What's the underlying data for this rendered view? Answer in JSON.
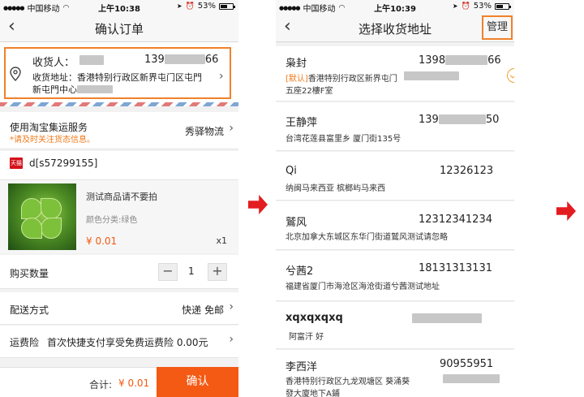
{
  "status_bar": {
    "carrier": "中国移动",
    "wifi_icon": "wifi-icon",
    "left_time": "上午10:38",
    "right_time": "上午10:39",
    "battery": "53%"
  },
  "order_screen": {
    "title": "确认订单",
    "back_icon": "chevron-left-icon",
    "recipient_label": "收货人：",
    "recipient_phone_visible": "139",
    "recipient_phone_tail": "66",
    "address_label": "收货地址：",
    "address_line1": "香港特别行政区新界屯门区屯門",
    "address_line2": "新屯門中心",
    "shipping_service_label": "使用淘宝集运服务",
    "shipping_service_value": "秀驿物流",
    "shipping_note": "*请及时关注货态信息。",
    "shop_badge": "天猫",
    "shop_name": "d[s57299155]",
    "product_title": "测试商品请不要拍",
    "product_spec": "颜色分类:绿色",
    "product_price": "¥ 0.01",
    "product_qty": "x1",
    "quantity_label": "购买数量",
    "quantity_minus": "−",
    "quantity_value": "1",
    "quantity_plus": "+",
    "delivery_label": "配送方式",
    "delivery_value": "快递 免邮",
    "insurance_label": "运费险",
    "insurance_value": "首次快捷支付享受免费运费险 0.00元",
    "total_label": "合计:",
    "total_value": "¥ 0.01",
    "confirm_button": "确认"
  },
  "address_screen": {
    "title": "选择收货地址",
    "manage_button": "管理",
    "addresses": [
      {
        "name": "枭封",
        "phone": "1398",
        "phone_tail": "66",
        "default_tag": "[默认]",
        "address": "香港特别行政区新界屯门",
        "address2": "五座22樓F室",
        "selected": true
      },
      {
        "name": "王静萍",
        "phone": "139",
        "phone_tail": "50",
        "address": "台湾花莲县富里乡 厦门街135号"
      },
      {
        "name": "Qi",
        "phone": "12326123",
        "address": "纳闽马来西亚  槟榔屿马来西"
      },
      {
        "name": "鷲风",
        "phone": "12312341234",
        "address": "北京加拿大东城区东华门街道鷲风测试请忽略"
      },
      {
        "name": "兮茜2",
        "phone": "18131313131",
        "address": "福建省厦门市海沧区海沧街道兮茜测试地址"
      },
      {
        "name": "xqxqxqxq",
        "phone": "",
        "address": "阿富汗  好"
      },
      {
        "name": "李西洋",
        "phone": "90955951",
        "address": "香港特别行政区九龙观塘区 葵涌葵",
        "address2": "發大廈地下A鋪"
      }
    ]
  },
  "colors": {
    "accent": "#f0812a",
    "confirm": "#f45a14",
    "arrow": "#e31c20"
  }
}
